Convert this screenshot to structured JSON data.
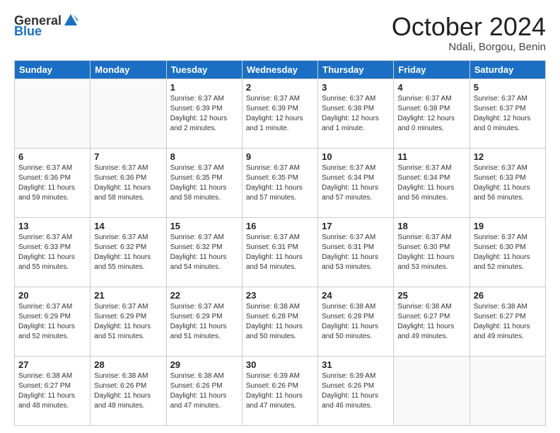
{
  "header": {
    "logo_general": "General",
    "logo_blue": "Blue",
    "title": "October 2024",
    "location": "Ndali, Borgou, Benin"
  },
  "days_of_week": [
    "Sunday",
    "Monday",
    "Tuesday",
    "Wednesday",
    "Thursday",
    "Friday",
    "Saturday"
  ],
  "weeks": [
    [
      {
        "day": "",
        "info": ""
      },
      {
        "day": "",
        "info": ""
      },
      {
        "day": "1",
        "info": "Sunrise: 6:37 AM\nSunset: 6:39 PM\nDaylight: 12 hours\nand 2 minutes."
      },
      {
        "day": "2",
        "info": "Sunrise: 6:37 AM\nSunset: 6:39 PM\nDaylight: 12 hours\nand 1 minute."
      },
      {
        "day": "3",
        "info": "Sunrise: 6:37 AM\nSunset: 6:38 PM\nDaylight: 12 hours\nand 1 minute."
      },
      {
        "day": "4",
        "info": "Sunrise: 6:37 AM\nSunset: 6:38 PM\nDaylight: 12 hours\nand 0 minutes."
      },
      {
        "day": "5",
        "info": "Sunrise: 6:37 AM\nSunset: 6:37 PM\nDaylight: 12 hours\nand 0 minutes."
      }
    ],
    [
      {
        "day": "6",
        "info": "Sunrise: 6:37 AM\nSunset: 6:36 PM\nDaylight: 11 hours\nand 59 minutes."
      },
      {
        "day": "7",
        "info": "Sunrise: 6:37 AM\nSunset: 6:36 PM\nDaylight: 11 hours\nand 58 minutes."
      },
      {
        "day": "8",
        "info": "Sunrise: 6:37 AM\nSunset: 6:35 PM\nDaylight: 11 hours\nand 58 minutes."
      },
      {
        "day": "9",
        "info": "Sunrise: 6:37 AM\nSunset: 6:35 PM\nDaylight: 11 hours\nand 57 minutes."
      },
      {
        "day": "10",
        "info": "Sunrise: 6:37 AM\nSunset: 6:34 PM\nDaylight: 11 hours\nand 57 minutes."
      },
      {
        "day": "11",
        "info": "Sunrise: 6:37 AM\nSunset: 6:34 PM\nDaylight: 11 hours\nand 56 minutes."
      },
      {
        "day": "12",
        "info": "Sunrise: 6:37 AM\nSunset: 6:33 PM\nDaylight: 11 hours\nand 56 minutes."
      }
    ],
    [
      {
        "day": "13",
        "info": "Sunrise: 6:37 AM\nSunset: 6:33 PM\nDaylight: 11 hours\nand 55 minutes."
      },
      {
        "day": "14",
        "info": "Sunrise: 6:37 AM\nSunset: 6:32 PM\nDaylight: 11 hours\nand 55 minutes."
      },
      {
        "day": "15",
        "info": "Sunrise: 6:37 AM\nSunset: 6:32 PM\nDaylight: 11 hours\nand 54 minutes."
      },
      {
        "day": "16",
        "info": "Sunrise: 6:37 AM\nSunset: 6:31 PM\nDaylight: 11 hours\nand 54 minutes."
      },
      {
        "day": "17",
        "info": "Sunrise: 6:37 AM\nSunset: 6:31 PM\nDaylight: 11 hours\nand 53 minutes."
      },
      {
        "day": "18",
        "info": "Sunrise: 6:37 AM\nSunset: 6:30 PM\nDaylight: 11 hours\nand 53 minutes."
      },
      {
        "day": "19",
        "info": "Sunrise: 6:37 AM\nSunset: 6:30 PM\nDaylight: 11 hours\nand 52 minutes."
      }
    ],
    [
      {
        "day": "20",
        "info": "Sunrise: 6:37 AM\nSunset: 6:29 PM\nDaylight: 11 hours\nand 52 minutes."
      },
      {
        "day": "21",
        "info": "Sunrise: 6:37 AM\nSunset: 6:29 PM\nDaylight: 11 hours\nand 51 minutes."
      },
      {
        "day": "22",
        "info": "Sunrise: 6:37 AM\nSunset: 6:29 PM\nDaylight: 11 hours\nand 51 minutes."
      },
      {
        "day": "23",
        "info": "Sunrise: 6:38 AM\nSunset: 6:28 PM\nDaylight: 11 hours\nand 50 minutes."
      },
      {
        "day": "24",
        "info": "Sunrise: 6:38 AM\nSunset: 6:28 PM\nDaylight: 11 hours\nand 50 minutes."
      },
      {
        "day": "25",
        "info": "Sunrise: 6:38 AM\nSunset: 6:27 PM\nDaylight: 11 hours\nand 49 minutes."
      },
      {
        "day": "26",
        "info": "Sunrise: 6:38 AM\nSunset: 6:27 PM\nDaylight: 11 hours\nand 49 minutes."
      }
    ],
    [
      {
        "day": "27",
        "info": "Sunrise: 6:38 AM\nSunset: 6:27 PM\nDaylight: 11 hours\nand 48 minutes."
      },
      {
        "day": "28",
        "info": "Sunrise: 6:38 AM\nSunset: 6:26 PM\nDaylight: 11 hours\nand 48 minutes."
      },
      {
        "day": "29",
        "info": "Sunrise: 6:38 AM\nSunset: 6:26 PM\nDaylight: 11 hours\nand 47 minutes."
      },
      {
        "day": "30",
        "info": "Sunrise: 6:39 AM\nSunset: 6:26 PM\nDaylight: 11 hours\nand 47 minutes."
      },
      {
        "day": "31",
        "info": "Sunrise: 6:39 AM\nSunset: 6:26 PM\nDaylight: 11 hours\nand 46 minutes."
      },
      {
        "day": "",
        "info": ""
      },
      {
        "day": "",
        "info": ""
      }
    ]
  ]
}
